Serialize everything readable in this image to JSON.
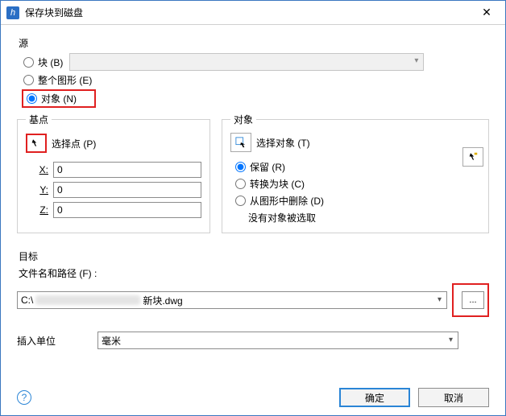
{
  "window": {
    "title": "保存块到磁盘",
    "app_icon_letter": "h"
  },
  "source": {
    "group_label": "源",
    "radio_block": "块 (B)",
    "radio_whole": "整个图形 (E)",
    "radio_objects": "对象 (N)",
    "selected": "objects"
  },
  "basepoint": {
    "legend": "基点",
    "pick_label": "选择点 (P)",
    "x_label": "X:",
    "y_label": "Y:",
    "z_label": "Z:",
    "x": "0",
    "y": "0",
    "z": "0"
  },
  "objects": {
    "legend": "对象",
    "select_label": "选择对象 (T)",
    "radio_retain": "保留 (R)",
    "radio_convert": "转换为块 (C)",
    "radio_delete": "从图形中删除 (D)",
    "status": "没有对象被选取",
    "selected": "retain"
  },
  "target": {
    "section_label": "目标",
    "path_label": "文件名和路径 (F) :",
    "path_prefix": "C:\\",
    "path_suffix": "新块.dwg",
    "browse_label": "...",
    "units_label": "插入单位",
    "units_value": "毫米"
  },
  "buttons": {
    "ok": "确定",
    "cancel": "取消",
    "help": "?"
  }
}
